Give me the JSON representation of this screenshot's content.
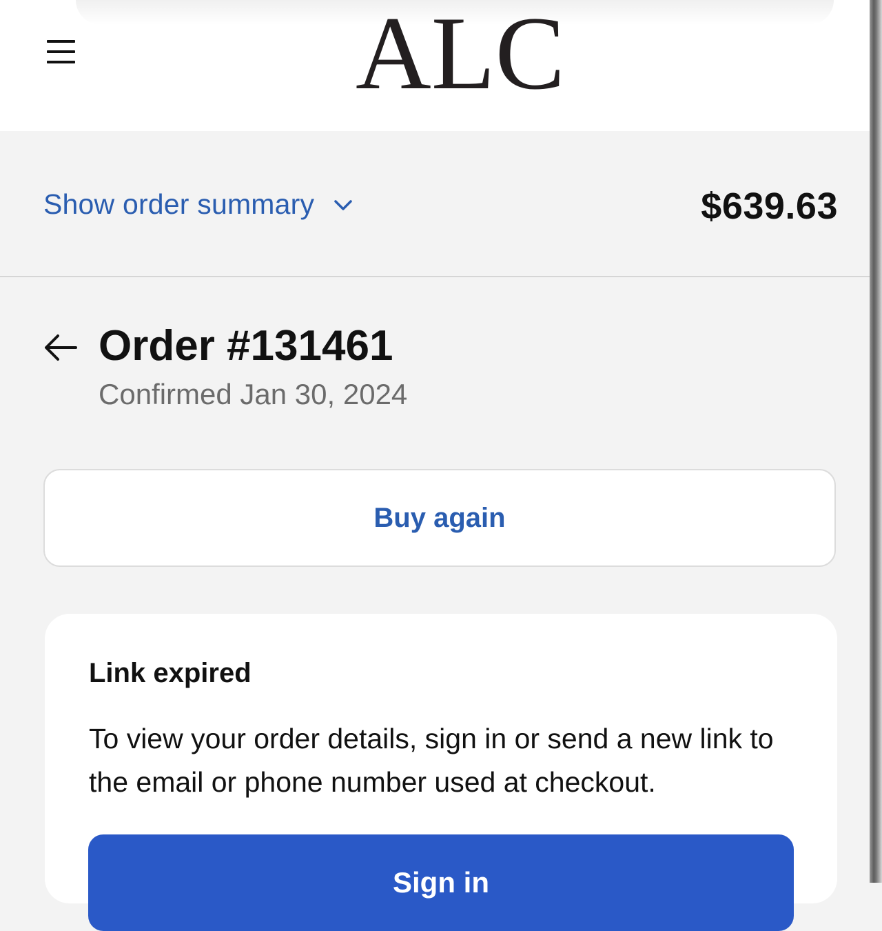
{
  "header": {
    "logo_text": "ALC",
    "menu_icon": "hamburger-menu-icon"
  },
  "summary": {
    "toggle_label": "Show order summary",
    "toggle_icon": "chevron-down-icon",
    "total": "$639.63"
  },
  "order": {
    "back_icon": "arrow-left-icon",
    "title": "Order #131461",
    "confirmed": "Confirmed Jan 30, 2024"
  },
  "actions": {
    "buy_again_label": "Buy again"
  },
  "notice": {
    "title": "Link expired",
    "body": "To view your order details, sign in or send a new link to the email or phone number used at checkout.",
    "signin_label": "Sign in"
  },
  "colors": {
    "link_blue": "#2a5db0",
    "primary_button": "#2a59c7",
    "page_background": "#f3f3f3"
  }
}
